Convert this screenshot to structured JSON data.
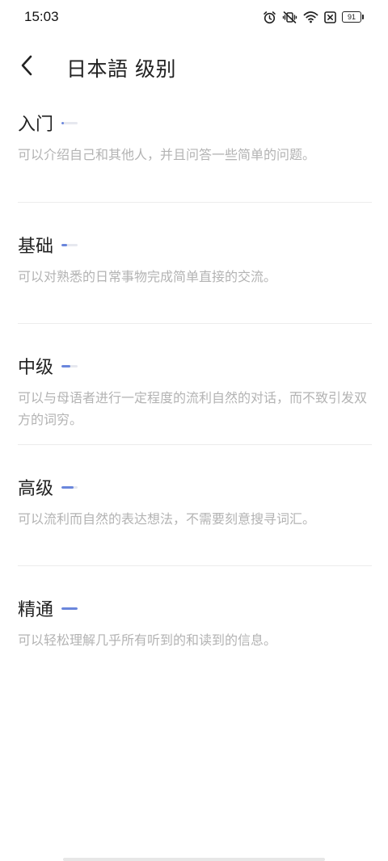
{
  "status_bar": {
    "time": "15:03",
    "battery": "91",
    "icons": [
      "alarm-icon",
      "mute-vibrate-icon",
      "wifi-icon",
      "sim-blocked-icon",
      "battery-icon"
    ]
  },
  "header": {
    "back_icon": "chevron-left-icon",
    "title": "日本語 级别"
  },
  "levels": [
    {
      "name": "入门",
      "progress": 0.15,
      "description": "可以介绍自己和其他人，并且问答一些简单的问题。"
    },
    {
      "name": "基础",
      "progress": 0.35,
      "description": "可以对熟悉的日常事物完成简单直接的交流。"
    },
    {
      "name": "中级",
      "progress": 0.55,
      "description": "可以与母语者进行一定程度的流利自然的对话，而不致引发双方的词穷。"
    },
    {
      "name": "高级",
      "progress": 0.75,
      "description": "可以流利而自然的表达想法，不需要刻意搜寻词汇。"
    },
    {
      "name": "精通",
      "progress": 1.0,
      "description": "可以轻松理解几乎所有听到的和读到的信息。"
    }
  ],
  "colors": {
    "accent": "#6a86dc",
    "track": "#e6e8ef",
    "description_text": "#b3b3b3",
    "divider": "#ececec"
  }
}
